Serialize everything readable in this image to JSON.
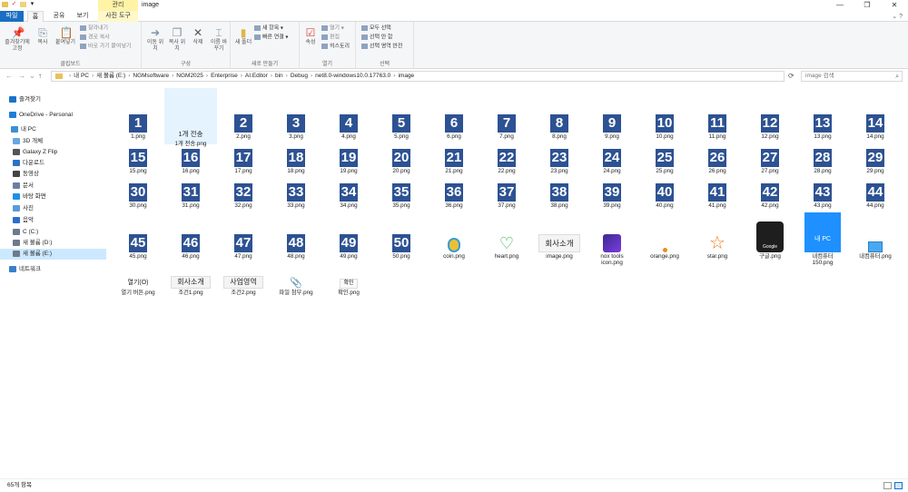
{
  "window": {
    "context_tab": "관리",
    "title": "image",
    "minimize": "—",
    "maximize": "❐",
    "close": "✕"
  },
  "tabs": [
    {
      "label": "파일"
    },
    {
      "label": "홈"
    },
    {
      "label": "공유"
    },
    {
      "label": "보기"
    },
    {
      "label": "사진 도구"
    }
  ],
  "ribbon": {
    "clipboard": {
      "label": "클립보드",
      "pin": "즐겨찾기에 고정",
      "copy": "복사",
      "paste": "붙여넣기",
      "cut": "잘라내기",
      "copy_path": "경로 복사",
      "paste_shortcut": "바로 가기 붙여넣기"
    },
    "organize": {
      "label": "구성",
      "move_to": "이동 위치",
      "copy_to": "복사 위치",
      "delete": "삭제",
      "rename": "이름 바꾸기"
    },
    "new": {
      "label": "새로 만들기",
      "new_folder": "새 폴더",
      "new_item": "새 항목",
      "easy_access": "빠른 연결"
    },
    "open": {
      "label": "열기",
      "properties": "속성",
      "open": "열기",
      "edit": "편집",
      "history": "히스토리"
    },
    "select": {
      "label": "선택",
      "select_all": "모두 선택",
      "select_none": "선택 안 함",
      "invert": "선택 영역 반전"
    }
  },
  "address": {
    "crumbs": [
      "내 PC",
      "새 볼륨 (E:)",
      "NGMsoftware",
      "NGM2025",
      "Enterprise",
      "AI.Editor",
      "bin",
      "Debug",
      "net8.0-windows10.0.17763.0",
      "image"
    ],
    "search_placeholder": "image 검색"
  },
  "nav": [
    {
      "label": "즐겨찾기",
      "color": "#1a73c9"
    },
    {
      "label": "OneDrive - Personal",
      "color": "#1f7fd8"
    },
    {
      "label": "내 PC",
      "color": "#3b8fd6"
    },
    {
      "label": "3D 개체",
      "color": "#6aa6e0"
    },
    {
      "label": "Galaxy Z Flip",
      "color": "#555555"
    },
    {
      "label": "다운로드",
      "color": "#2a73c8"
    },
    {
      "label": "동영상",
      "color": "#444444"
    },
    {
      "label": "문서",
      "color": "#6b7fa0"
    },
    {
      "label": "바탕 화면",
      "color": "#1e90e8"
    },
    {
      "label": "사진",
      "color": "#5b9ad8"
    },
    {
      "label": "음악",
      "color": "#2b6ecb"
    },
    {
      "label": "C (C:)",
      "color": "#6d7b8c"
    },
    {
      "label": "새 볼륨 (D:)",
      "color": "#6d7b8c"
    },
    {
      "label": "새 볼륨 (E:)",
      "color": "#6d7b8c"
    },
    {
      "label": "네트워크",
      "color": "#3a7fc9"
    }
  ],
  "files_top_label_second": "1개 전송",
  "files": [
    {
      "name": "1.png",
      "num": "1"
    },
    {
      "name": "1개 전송.png",
      "num": ""
    },
    {
      "name": "2.png",
      "num": "2"
    },
    {
      "name": "3.png",
      "num": "3"
    },
    {
      "name": "4.png",
      "num": "4"
    },
    {
      "name": "5.png",
      "num": "5"
    },
    {
      "name": "6.png",
      "num": "6"
    },
    {
      "name": "7.png",
      "num": "7"
    },
    {
      "name": "8.png",
      "num": "8"
    },
    {
      "name": "9.png",
      "num": "9"
    },
    {
      "name": "10.png",
      "num": "10"
    },
    {
      "name": "11.png",
      "num": "11"
    },
    {
      "name": "12.png",
      "num": "12"
    },
    {
      "name": "13.png",
      "num": "13"
    },
    {
      "name": "14.png",
      "num": "14"
    },
    {
      "name": "15.png",
      "num": "15"
    },
    {
      "name": "16.png",
      "num": "16"
    },
    {
      "name": "17.png",
      "num": "17"
    },
    {
      "name": "18.png",
      "num": "18"
    },
    {
      "name": "19.png",
      "num": "19"
    },
    {
      "name": "20.png",
      "num": "20"
    },
    {
      "name": "21.png",
      "num": "21"
    },
    {
      "name": "22.png",
      "num": "22"
    },
    {
      "name": "23.png",
      "num": "23"
    },
    {
      "name": "24.png",
      "num": "24"
    },
    {
      "name": "25.png",
      "num": "25"
    },
    {
      "name": "26.png",
      "num": "26"
    },
    {
      "name": "27.png",
      "num": "27"
    },
    {
      "name": "28.png",
      "num": "28"
    },
    {
      "name": "29.png",
      "num": "29"
    },
    {
      "name": "30.png",
      "num": "30"
    },
    {
      "name": "31.png",
      "num": "31"
    },
    {
      "name": "32.png",
      "num": "32"
    },
    {
      "name": "33.png",
      "num": "33"
    },
    {
      "name": "34.png",
      "num": "34"
    },
    {
      "name": "35.png",
      "num": "35"
    },
    {
      "name": "36.png",
      "num": "36"
    },
    {
      "name": "37.png",
      "num": "37"
    },
    {
      "name": "38.png",
      "num": "38"
    },
    {
      "name": "39.png",
      "num": "39"
    },
    {
      "name": "40.png",
      "num": "40"
    },
    {
      "name": "41.png",
      "num": "41"
    },
    {
      "name": "42.png",
      "num": "42"
    },
    {
      "name": "43.png",
      "num": "43"
    },
    {
      "name": "44.png",
      "num": "44"
    },
    {
      "name": "45.png",
      "num": "45"
    },
    {
      "name": "46.png",
      "num": "46"
    },
    {
      "name": "47.png",
      "num": "47"
    },
    {
      "name": "48.png",
      "num": "48"
    },
    {
      "name": "49.png",
      "num": "49"
    },
    {
      "name": "50.png",
      "num": "50"
    },
    {
      "name": "coin.png",
      "num": ""
    },
    {
      "name": "heart.png",
      "num": ""
    },
    {
      "name": "image.png",
      "num": ""
    },
    {
      "name": "nox tools icon.png",
      "num": ""
    },
    {
      "name": "orange.png",
      "num": ""
    },
    {
      "name": "star.png",
      "num": ""
    },
    {
      "name": "구글.png",
      "num": ""
    },
    {
      "name": "내컴퓨터 150.png",
      "num": ""
    },
    {
      "name": "내컴퓨터.png",
      "num": ""
    },
    {
      "name": "열기 버튼.png",
      "num": ""
    },
    {
      "name": "조건1.png",
      "num": ""
    },
    {
      "name": "조건2.png",
      "num": ""
    },
    {
      "name": "파일 첨부.png",
      "num": ""
    },
    {
      "name": "확인.png",
      "num": ""
    }
  ],
  "thumb_text": {
    "image": "회사소개",
    "my_pc": "내 PC",
    "google": "Google",
    "open_button": "열기(O)",
    "cond1": "회사소개",
    "cond2": "사업영역",
    "confirm": "확인"
  },
  "status": {
    "count": "65개 항목"
  },
  "colors": {
    "tile_blue": "#2d5293",
    "file_tab": "#1a6fc1",
    "selection": "#cce8ff"
  }
}
